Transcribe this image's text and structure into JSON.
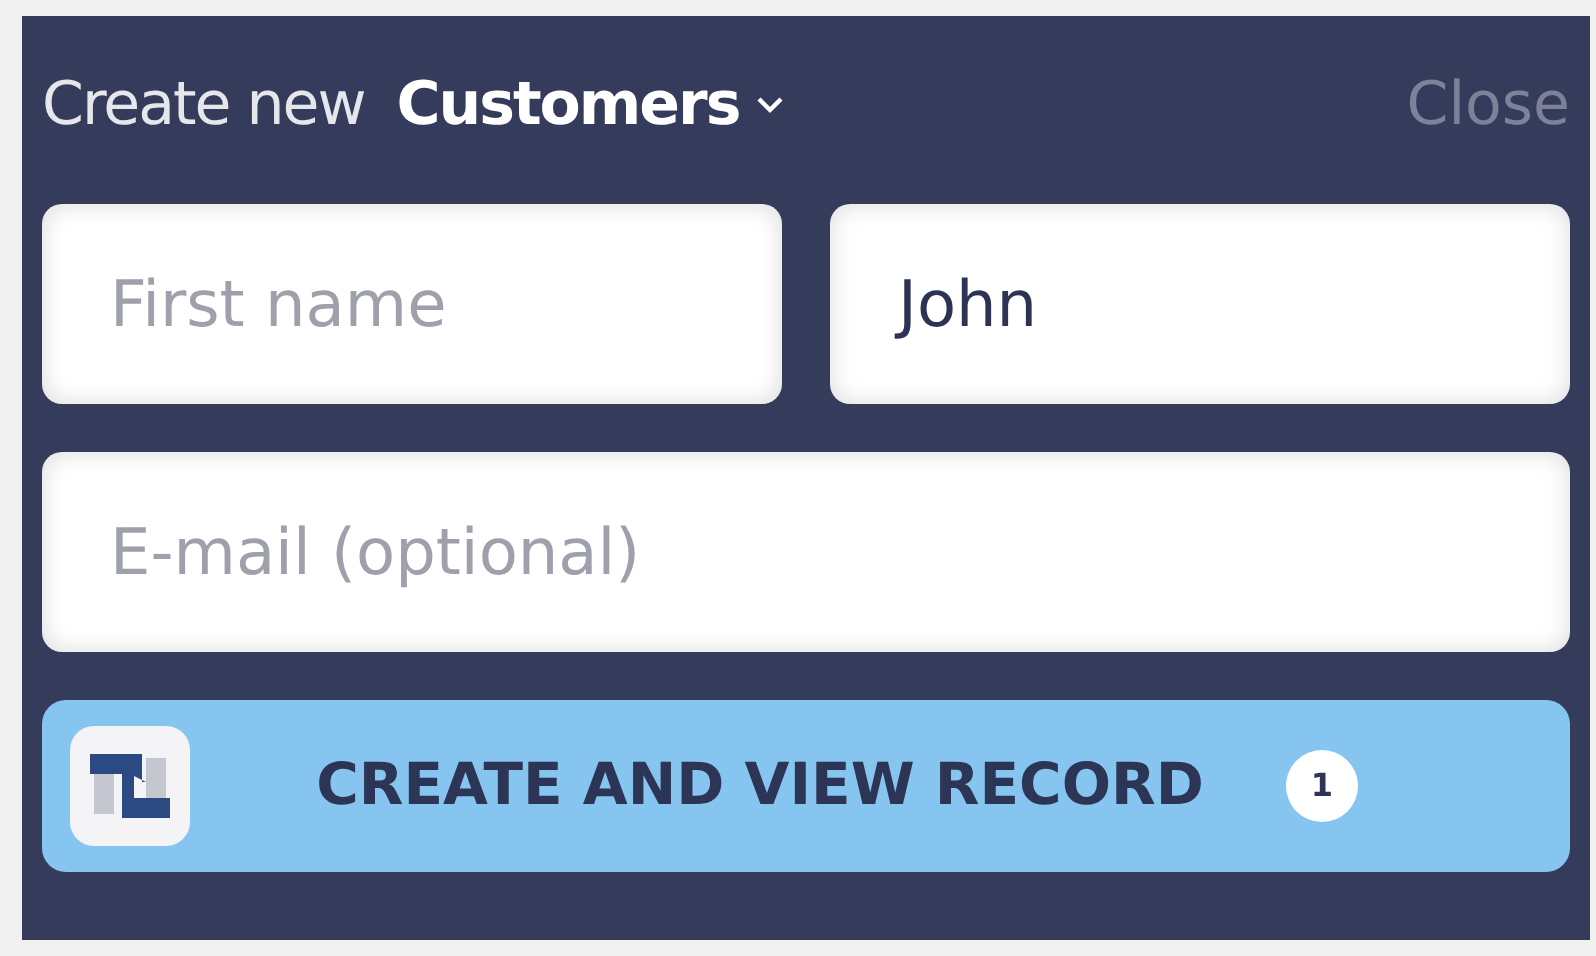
{
  "header": {
    "prefix": "Create new",
    "record_type": "Customers",
    "close": "Close"
  },
  "fields": [
    {
      "placeholder": "First name"
    },
    {
      "value": "John"
    },
    {
      "placeholder": "E-mail (optional)"
    }
  ],
  "action": {
    "label": "CREATE AND VIEW RECORD",
    "badge": "1"
  }
}
